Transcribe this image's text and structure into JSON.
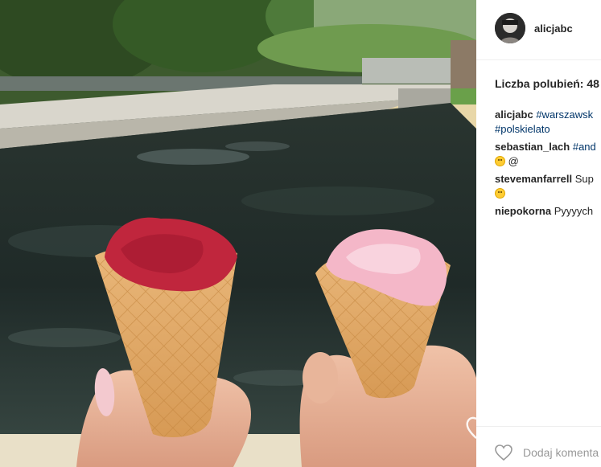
{
  "post": {
    "username": "alicjabc",
    "likes_label": "Liczba polubień: 48",
    "comments": [
      {
        "author": "alicjabc",
        "text": "#warszawsk",
        "line2": "#polskielato"
      },
      {
        "author": "sebastian_lach",
        "text": "#and",
        "line2": "@"
      },
      {
        "author": "stevemanfarrell",
        "text": "Sup"
      },
      {
        "author": "niepokorna",
        "text": "Pyyyych"
      }
    ],
    "add_comment_placeholder": "Dodaj komenta"
  },
  "icons": {
    "like": "heart-icon",
    "avatar": "avatar"
  },
  "colors": {
    "hashtag": "#003569",
    "text": "#262626",
    "placeholder": "#999999"
  }
}
